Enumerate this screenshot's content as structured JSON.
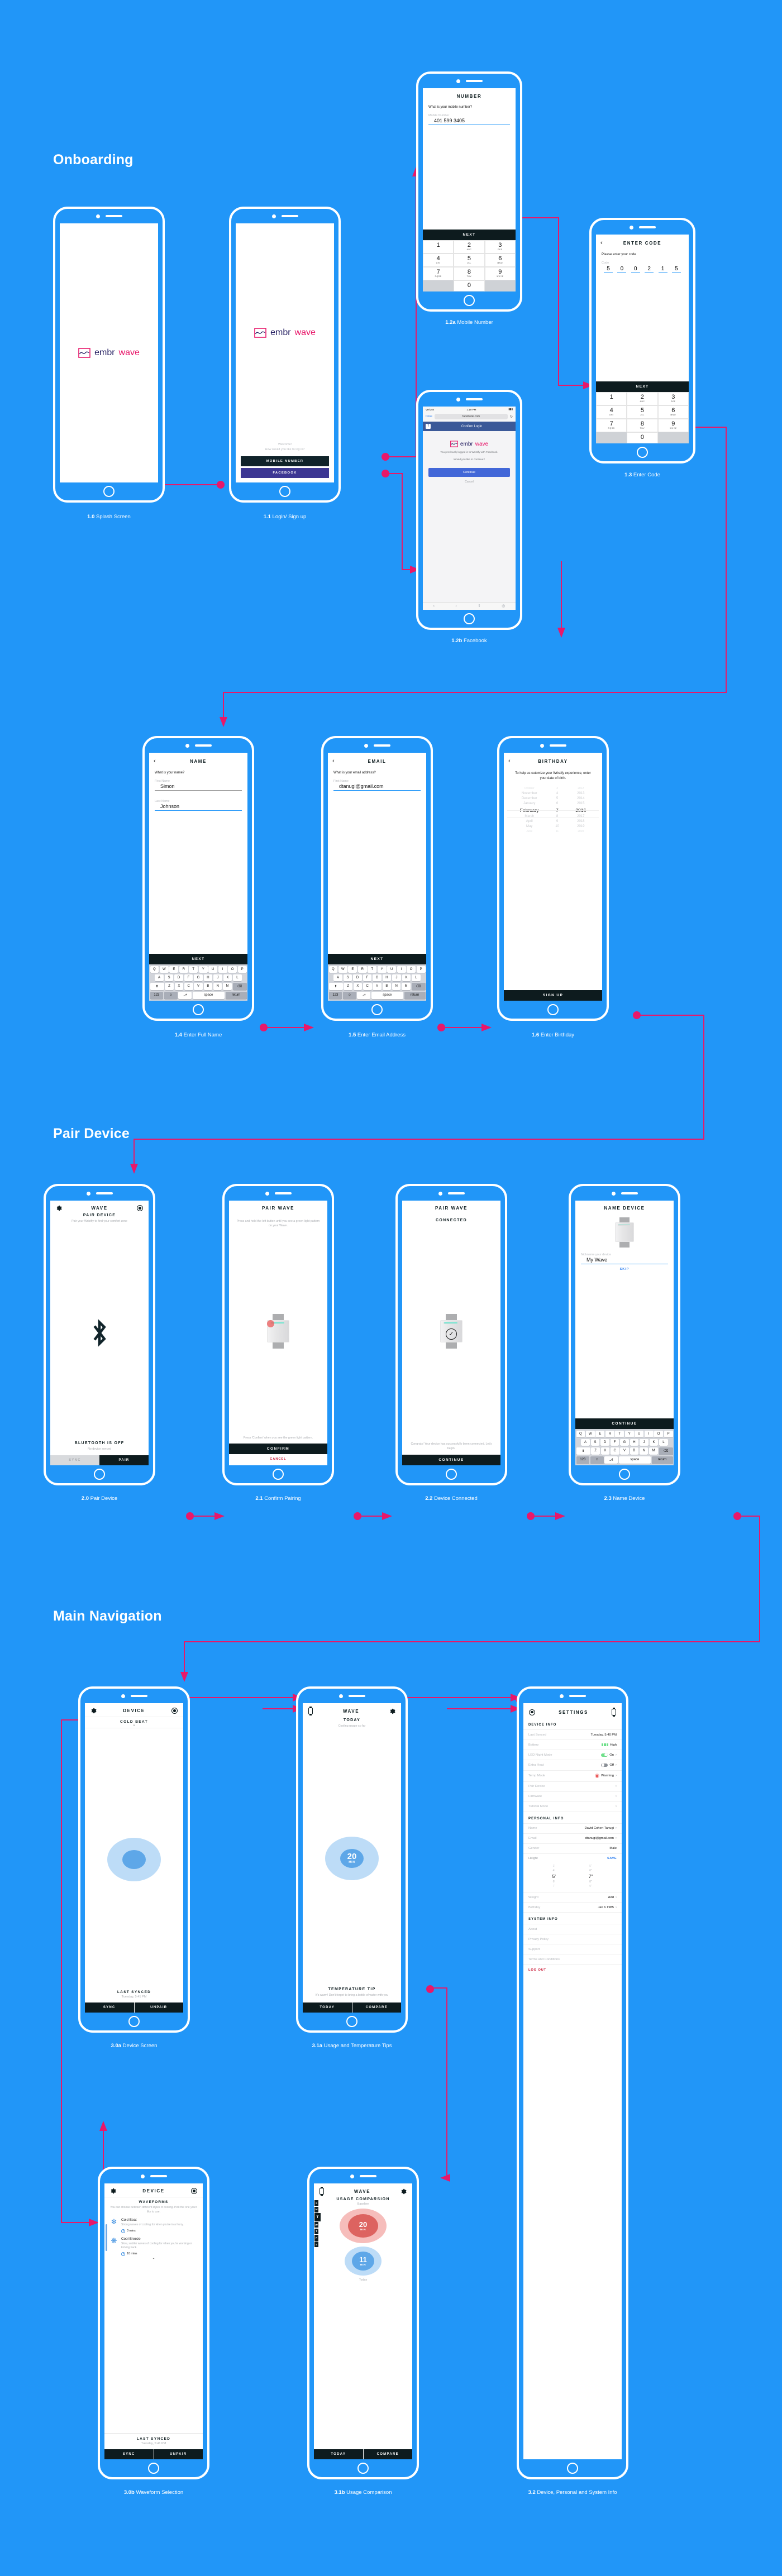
{
  "sections": {
    "onboarding": "Onboarding",
    "pair_device": "Pair Device",
    "main_navigation": "Main Navigation"
  },
  "brand": {
    "name_dark": "embr",
    "name_pink": "wave",
    "colors": {
      "background": "#2196f8",
      "accent_pink": "#e8186a",
      "dark": "#0d1b1e",
      "brand_navy": "#201a5e"
    }
  },
  "captions": {
    "s10": {
      "num": "1.0",
      "label": "Splash Screen"
    },
    "s11": {
      "num": "1.1",
      "label": "Login/ Sign up"
    },
    "s12a": {
      "num": "1.2a",
      "label": "Mobile Number"
    },
    "s12b": {
      "num": "1.2b",
      "label": "Facebook"
    },
    "s13": {
      "num": "1.3",
      "label": "Enter Code"
    },
    "s14": {
      "num": "1.4",
      "label": "Enter Full Name"
    },
    "s15": {
      "num": "1.5",
      "label": "Enter Email Address"
    },
    "s16": {
      "num": "1.6",
      "label": "Enter Birthday"
    },
    "s20": {
      "num": "2.0",
      "label": "Pair Device"
    },
    "s21": {
      "num": "2.1",
      "label": "Confirm Pairing"
    },
    "s22": {
      "num": "2.2",
      "label": "Device Connected"
    },
    "s23": {
      "num": "2.3",
      "label": "Name Device"
    },
    "s30a": {
      "num": "3.0a",
      "label": "Device Screen"
    },
    "s31a": {
      "num": "3.1a",
      "label": "Usage and Temperature Tips"
    },
    "s32": {
      "num": "3.2",
      "label": "Device, Personal and System Info"
    },
    "s30b": {
      "num": "3.0b",
      "label": "Waveform Selection"
    },
    "s31b": {
      "num": "3.1b",
      "label": "Usage Comparison"
    }
  },
  "screens": {
    "login": {
      "welcome_line1": "Welcome!",
      "welcome_line2": "How would you like to log in?",
      "mobile_button": "MOBILE NUMBER",
      "facebook_button": "FACEBOOK"
    },
    "mobile_number": {
      "title": "NUMBER",
      "prompt": "What is your mobile number?",
      "field_label": "Mobile Number",
      "field_value": "401 599 3405",
      "next": "NEXT"
    },
    "facebook": {
      "carrier": "Verizon",
      "time": "1:19 PM",
      "done": "Done",
      "url": "facebook.com",
      "bar_title": "Confirm Login",
      "body_line1": "You previously logged in to Wristify with Facebook.",
      "body_line2": "Would you like to continue?",
      "continue": "Continue",
      "cancel": "Cancel"
    },
    "enter_code": {
      "title": "ENTER CODE",
      "prompt": "Please enter your code",
      "field_label": "Code",
      "digits": [
        "5",
        "0",
        "0",
        "2",
        "1",
        "5"
      ],
      "next": "NEXT"
    },
    "name": {
      "title": "NAME",
      "prompt": "What is your name?",
      "first_label": "First Name",
      "first_value": "Simon",
      "last_label": "Last Name",
      "last_value": "Johnson",
      "next": "NEXT"
    },
    "email": {
      "title": "EMAIL",
      "prompt": "What is your email address?",
      "field_label": "First Name",
      "field_value": "dtanugi@gmail.com",
      "next": "NEXT"
    },
    "birthday": {
      "title": "BIRTHDAY",
      "prompt": "To help us cutomize your Wristify experience, enter your date of birth.",
      "months_above": [
        "October",
        "November",
        "December",
        "January"
      ],
      "month_selected": "February",
      "months_below": [
        "March",
        "April",
        "May",
        "June"
      ],
      "days_above": [
        "3",
        "4",
        "5",
        "6"
      ],
      "day_selected": "7",
      "days_below": [
        "8",
        "9",
        "10",
        "11"
      ],
      "years_above": [
        "2012",
        "2013",
        "2014",
        "2015"
      ],
      "year_selected": "2016",
      "years_below": [
        "2017",
        "2018",
        "2019",
        "2020"
      ],
      "signup": "SIGN UP"
    },
    "pair_device": {
      "navtitle": "WAVE",
      "heading": "PAIR DEVICE",
      "sub": "Pair your Wristfiy to find your comfort zone",
      "status": "BLUETOOTH IS OFF",
      "status_sub": "No device synced",
      "sync": "SYNC",
      "pair": "PAIR"
    },
    "confirm_pairing": {
      "title": "PAIR WAVE",
      "instruction": "Press and hold the left button until you see a green light pattern on your Wave.",
      "instruction2": "Press 'Confirm' when you see the green light pattern.",
      "confirm": "CONFIRM",
      "cancel": "CANCEL"
    },
    "device_connected": {
      "title": "PAIR WAVE",
      "status": "CONNECTED",
      "message": "Congrats! Your device has successfully been connected. Let's begin.",
      "continue": "CONTINUE"
    },
    "name_device": {
      "title": "NAME DEVICE",
      "field_label": "Nickname your device",
      "field_value": "My Wave",
      "skip": "SKIP",
      "continue": "CONTINUE"
    },
    "device_screen": {
      "navtitle": "DEVICE",
      "mode": "COLD BEAT",
      "last_synced_label": "LAST SYNCED",
      "last_synced_value": "Tuesday, 5:41 PM",
      "sync": "SYNC",
      "unpair": "UNPAIR"
    },
    "usage_today": {
      "navtitle": "WAVE",
      "heading": "TODAY",
      "sub": "Cooling usage so far",
      "value": "20",
      "unit": "MIN",
      "tip_title": "TEMPERATURE TIP",
      "tip_body": "It's warm! Don't forget to bring a bottle of water with you",
      "tab_today": "TODAY",
      "tab_compare": "COMPARE"
    },
    "waveform_selection": {
      "navtitle": "DEVICE",
      "heading": "WAVEFORMS",
      "sub": "You can choose between different styles of cooling. Pick the one you'd like to use.",
      "items": [
        {
          "icon": "snowflake-icon",
          "name": "Cold Beat",
          "desc": "Strong waves of cooling for when you're in a hurry.",
          "time": "3 mins"
        },
        {
          "icon": "fan-icon",
          "name": "Cool Breeze",
          "desc": "Slow, subtler waves of cooling for when you're working or kicking back.",
          "time": "10 mins"
        }
      ],
      "last_synced_label": "LAST SYNCED",
      "last_synced_value": "Tuesday, 5:41 PM",
      "sync": "SYNC",
      "unpair": "UNPAIR"
    },
    "usage_comparison": {
      "navtitle": "WAVE",
      "heading": "USAGE COMPARSION",
      "baseline_label": "Baseline",
      "baseline_value": "20",
      "baseline_unit": "MIN",
      "today_value": "11",
      "today_unit": "MIN",
      "today_label": "Today",
      "days": [
        "S",
        "M",
        "T",
        "W",
        "T",
        "F",
        "S"
      ],
      "active_day_index": 2,
      "tab_today": "TODAY",
      "tab_compare": "COMPARE"
    },
    "settings": {
      "navtitle": "SETTINGS",
      "device_info_header": "DEVICE INFO",
      "device_rows": [
        {
          "key": "Last Synced",
          "value": "Tuesday, 5:40 PM",
          "type": "text"
        },
        {
          "key": "Battery",
          "value": "High",
          "type": "battery"
        },
        {
          "key": "LED Night Mode",
          "value": "On",
          "type": "toggle-on"
        },
        {
          "key": "Extra Heat",
          "value": "Off",
          "type": "toggle-off"
        },
        {
          "key": "Temp Mode",
          "value": "Warming",
          "type": "radio"
        },
        {
          "key": "Pair Device",
          "value": "",
          "type": "chevron"
        },
        {
          "key": "Firmware",
          "value": "",
          "type": "chevron"
        },
        {
          "key": "Tutorial Mode",
          "value": "",
          "type": "chevron"
        }
      ],
      "personal_info_header": "PERSONAL INFO",
      "personal_rows": [
        {
          "key": "Name",
          "value": "David Cohen-Tanugi",
          "type": "chevron"
        },
        {
          "key": "Email",
          "value": "dtanugi@gmail.com",
          "type": "chevron"
        },
        {
          "key": "Gender",
          "value": "Male",
          "type": "text"
        }
      ],
      "height_label": "Height",
      "height_save": "SAVE",
      "height_feet_above": [
        "3'",
        "4'"
      ],
      "height_feet_selected": "5'",
      "height_feet_below": [
        "6'",
        "7'"
      ],
      "height_inches_above": [
        "5\"",
        "6\""
      ],
      "height_inches_selected": "7\"",
      "height_inches_below": [
        "8\"",
        "9\""
      ],
      "personal_rows2": [
        {
          "key": "Weight",
          "value": "Add",
          "type": "chevron"
        },
        {
          "key": "Birthday",
          "value": "Jan 6 1985",
          "type": "chevron"
        }
      ],
      "system_info_header": "SYSTEM INFO",
      "system_rows": [
        {
          "key": "About"
        },
        {
          "key": "Privacy Policy"
        },
        {
          "key": "Support"
        },
        {
          "key": "Terms and Conditions"
        }
      ],
      "logout": "LOG OUT"
    }
  },
  "keyboard": {
    "row1": [
      "Q",
      "W",
      "E",
      "R",
      "T",
      "Y",
      "U",
      "I",
      "O",
      "P"
    ],
    "row2": [
      "A",
      "S",
      "D",
      "F",
      "G",
      "H",
      "J",
      "K",
      "L"
    ],
    "row3": [
      "Z",
      "X",
      "C",
      "V",
      "B",
      "N",
      "M"
    ],
    "shift": "⬆",
    "backspace": "⌫",
    "num": "123",
    "emoji": "☺",
    "mic": "ᵨ",
    "space": "space",
    "return": "return"
  },
  "keypad": [
    {
      "num": "1",
      "abc": ""
    },
    {
      "num": "2",
      "abc": "ABC"
    },
    {
      "num": "3",
      "abc": "DEF"
    },
    {
      "num": "4",
      "abc": "GHI"
    },
    {
      "num": "5",
      "abc": "JKL"
    },
    {
      "num": "6",
      "abc": "MNO"
    },
    {
      "num": "7",
      "abc": "PQRS"
    },
    {
      "num": "8",
      "abc": "TUV"
    },
    {
      "num": "9",
      "abc": "WXYZ"
    },
    {
      "num": "",
      "abc": ""
    },
    {
      "num": "0",
      "abc": ""
    },
    {
      "num": "",
      "abc": ""
    }
  ]
}
